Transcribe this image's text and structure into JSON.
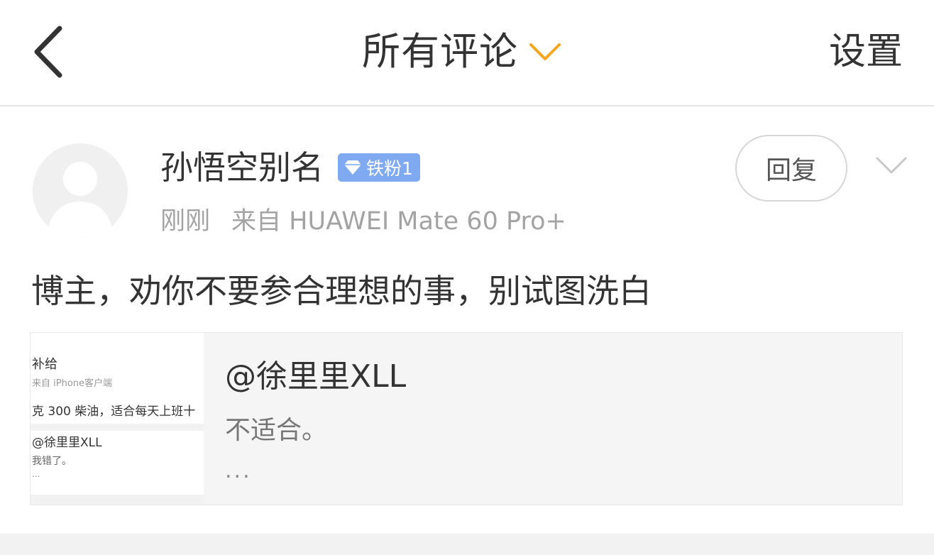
{
  "header": {
    "title": "所有评论",
    "settings_label": "设置"
  },
  "comment": {
    "username": "孙悟空别名",
    "badge_label": "铁粉1",
    "time": "刚刚",
    "source": "来自 HUAWEI Mate 60 Pro+",
    "reply_label": "回复",
    "text": "博主，劝你不要参合理想的事，别试图洗白"
  },
  "quote": {
    "user": "@徐里里XLL",
    "text": "不适合。",
    "ellipsis": "...",
    "thumbnail_lines": [
      "补给",
      "来自 iPhone客户端",
      "克 300 柴油，适合每天上班十",
      "@徐里里XLL",
      "我错了。",
      "..."
    ]
  },
  "colors": {
    "accent": "#f5a623",
    "badge": "#7fa9f0",
    "meta_gray": "#a3a3a3",
    "divider": "#e6e6e6"
  },
  "icons": {
    "back": "chevron-left-icon",
    "title_dropdown": "chevron-down-icon",
    "more": "chevron-down-icon",
    "badge": "diamond-icon"
  }
}
